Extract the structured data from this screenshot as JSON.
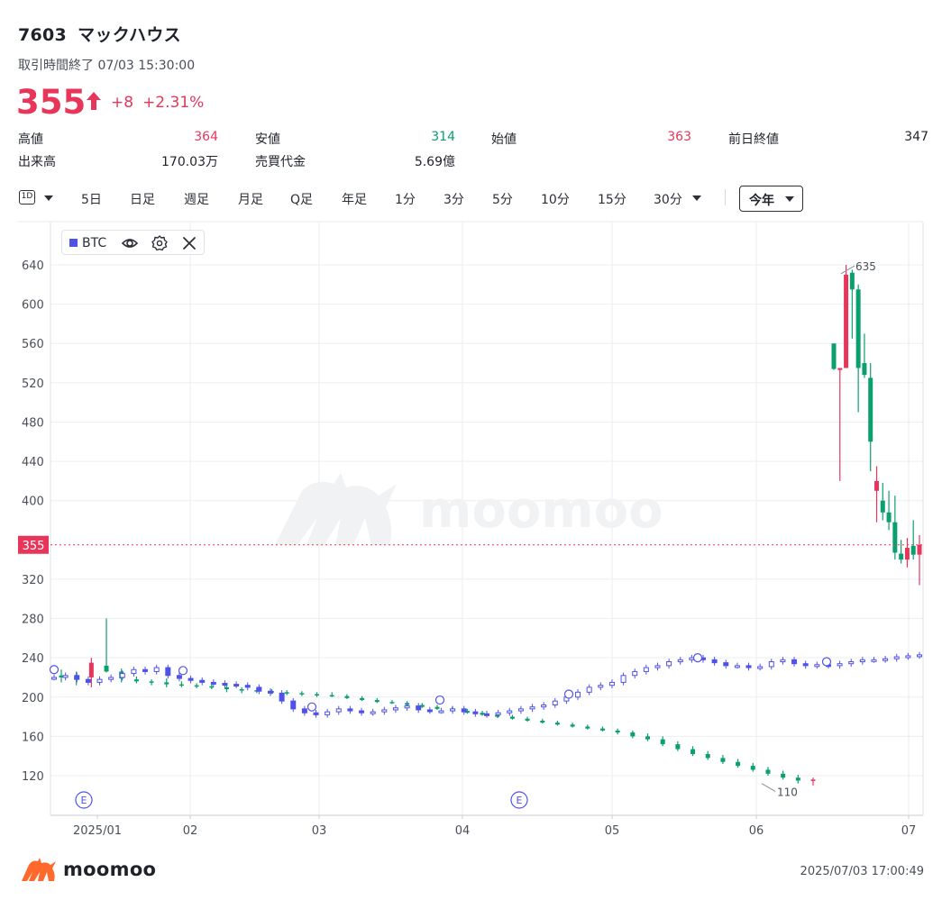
{
  "header": {
    "code": "7603",
    "name": "マックハウス",
    "status": "取引時間終了 07/03 15:30:00",
    "price": "355",
    "change": "+8",
    "change_pct": "+2.31%"
  },
  "stats": [
    {
      "label": "高値",
      "value": "364",
      "color": "red"
    },
    {
      "label": "安値",
      "value": "314",
      "color": "green"
    },
    {
      "label": "始値",
      "value": "363",
      "color": "red"
    },
    {
      "label": "前日終値",
      "value": "347",
      "color": "dark"
    },
    {
      "label": "出来高",
      "value": "170.03万",
      "color": "dark"
    },
    {
      "label": "売買代金",
      "value": "5.69億",
      "color": "dark"
    }
  ],
  "toolbar": {
    "interval_icon": "1D",
    "tabs": [
      "5日",
      "日足",
      "週足",
      "月足",
      "Q足",
      "年足",
      "1分",
      "3分",
      "5分",
      "10分",
      "15分",
      "30分"
    ],
    "period": "今年"
  },
  "legend": {
    "label": "BTC",
    "color": "#4f52e8",
    "icons": [
      "eye-icon",
      "gear-icon",
      "close-icon"
    ]
  },
  "watermark": "moomoo",
  "footer": {
    "brand": "moomoo",
    "timestamp": "2025/07/03 17:00:49"
  },
  "colors": {
    "up": "#e8365a",
    "down": "#0aa06e",
    "compare": "#4f52e8"
  },
  "chart_data": {
    "type": "candlestick",
    "ylim": [
      90,
      660
    ],
    "yticks": [
      640,
      600,
      560,
      520,
      480,
      440,
      400,
      320,
      280,
      240,
      200,
      160,
      120
    ],
    "xticks": [
      "2025/01",
      "02",
      "03",
      "04",
      "05",
      "06",
      "07"
    ],
    "current_price_label": "355",
    "annotations": {
      "high": "635",
      "low": "110"
    },
    "event_markers": [
      "E",
      "E"
    ],
    "series": [
      {
        "name": "7603",
        "type": "candlestick",
        "points": [
          [
            222,
            228,
            215,
            220
          ],
          [
            221,
            226,
            212,
            218
          ],
          [
            220,
            240,
            210,
            235
          ],
          [
            232,
            280,
            225,
            226
          ],
          [
            226,
            229,
            215,
            219
          ],
          [
            218,
            221,
            214,
            216
          ],
          [
            216,
            218,
            212,
            215
          ],
          [
            215,
            219,
            210,
            213
          ],
          [
            213,
            216,
            210,
            212
          ],
          [
            212,
            214,
            209,
            211
          ],
          [
            211,
            213,
            208,
            210
          ],
          [
            210,
            212,
            205,
            208
          ],
          [
            208,
            210,
            204,
            207
          ],
          [
            207,
            209,
            204,
            206
          ],
          [
            206,
            208,
            203,
            205
          ],
          [
            205,
            207,
            202,
            204
          ],
          [
            204,
            206,
            201,
            203
          ],
          [
            203,
            205,
            200,
            202
          ],
          [
            202,
            205,
            200,
            201
          ],
          [
            201,
            203,
            198,
            199
          ],
          [
            199,
            201,
            196,
            197
          ],
          [
            197,
            199,
            194,
            195
          ],
          [
            195,
            197,
            193,
            194
          ],
          [
            194,
            196,
            191,
            192
          ],
          [
            192,
            194,
            189,
            190
          ],
          [
            190,
            192,
            187,
            188
          ],
          [
            188,
            190,
            185,
            186
          ],
          [
            186,
            188,
            183,
            184
          ],
          [
            184,
            186,
            181,
            182
          ],
          [
            182,
            184,
            179,
            180
          ],
          [
            180,
            182,
            177,
            178
          ],
          [
            178,
            180,
            175,
            176
          ],
          [
            176,
            178,
            173,
            174
          ],
          [
            174,
            176,
            171,
            172
          ],
          [
            172,
            174,
            169,
            170
          ],
          [
            170,
            172,
            167,
            168
          ],
          [
            168,
            170,
            165,
            166
          ],
          [
            166,
            168,
            162,
            164
          ],
          [
            164,
            166,
            158,
            160
          ],
          [
            160,
            163,
            155,
            157
          ],
          [
            157,
            160,
            150,
            152
          ],
          [
            152,
            155,
            145,
            147
          ],
          [
            147,
            150,
            140,
            142
          ],
          [
            142,
            145,
            136,
            138
          ],
          [
            138,
            141,
            132,
            134
          ],
          [
            134,
            137,
            128,
            130
          ],
          [
            130,
            133,
            124,
            126
          ],
          [
            126,
            129,
            120,
            122
          ],
          [
            122,
            125,
            116,
            118
          ],
          [
            118,
            121,
            112,
            115
          ],
          [
            115,
            118,
            110,
            116
          ],
          [
            560,
            560,
            533,
            534
          ],
          [
            533,
            535,
            420,
            535
          ],
          [
            535,
            640,
            560,
            630
          ],
          [
            632,
            635,
            565,
            615
          ],
          [
            615,
            620,
            490,
            535
          ],
          [
            540,
            570,
            525,
            528
          ],
          [
            525,
            540,
            430,
            460
          ],
          [
            410,
            435,
            378,
            420
          ],
          [
            400,
            418,
            380,
            388
          ],
          [
            388,
            410,
            370,
            378
          ],
          [
            378,
            405,
            340,
            347
          ],
          [
            346,
            360,
            336,
            340
          ],
          [
            340,
            362,
            332,
            352
          ],
          [
            354,
            380,
            340,
            345
          ],
          [
            345,
            365,
            314,
            355
          ]
        ]
      },
      {
        "name": "BTC",
        "type": "compare",
        "values": [
          220,
          222,
          218,
          215,
          218,
          220,
          224,
          228,
          226,
          230,
          222,
          219,
          217,
          215,
          214,
          213,
          212,
          210,
          206,
          204,
          196,
          188,
          184,
          182,
          185,
          188,
          186,
          184,
          185,
          187,
          189,
          191,
          187,
          186,
          186,
          188,
          185,
          183,
          182,
          184,
          186,
          188,
          190,
          192,
          196,
          200,
          205,
          210,
          212,
          215,
          222,
          226,
          230,
          232,
          236,
          238,
          240,
          238,
          235,
          232,
          232,
          230,
          231,
          236,
          238,
          234,
          232,
          233,
          232,
          234,
          236,
          238,
          238,
          239,
          241,
          242,
          243
        ]
      }
    ]
  }
}
